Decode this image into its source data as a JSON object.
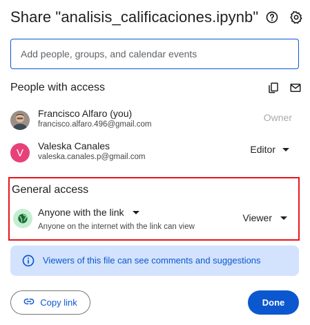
{
  "dialog": {
    "title": "Share \"analisis_calificaciones.ipynb\"",
    "help_icon": "help-circle-icon",
    "settings_icon": "gear-icon"
  },
  "add_people": {
    "placeholder": "Add people, groups, and calendar events",
    "value": ""
  },
  "people_section": {
    "title": "People with access",
    "copy_icon": "copy-emails-icon",
    "email_icon": "email-icon"
  },
  "people": [
    {
      "name": "Francisco Alfaro (you)",
      "email": "francisco.alfaro.496@gmail.com",
      "role": "Owner"
    },
    {
      "name": "Valeska Canales",
      "email": "valeska.canales.p@gmail.com",
      "role": "Editor",
      "avatar_letter": "V"
    }
  ],
  "general_access": {
    "title": "General access",
    "scope": "Anyone with the link",
    "description": "Anyone on the internet with the link can view",
    "role": "Viewer",
    "highlight_color": "#e8131c"
  },
  "info": {
    "text": "Viewers of this file can see comments and suggestions"
  },
  "footer": {
    "copy_link_label": "Copy link",
    "done_label": "Done"
  },
  "colors": {
    "accent": "#0b57d0",
    "info_bg": "#d3e3fd",
    "avatar_v": "#e8417a",
    "globe_bg": "#c4eed0"
  }
}
